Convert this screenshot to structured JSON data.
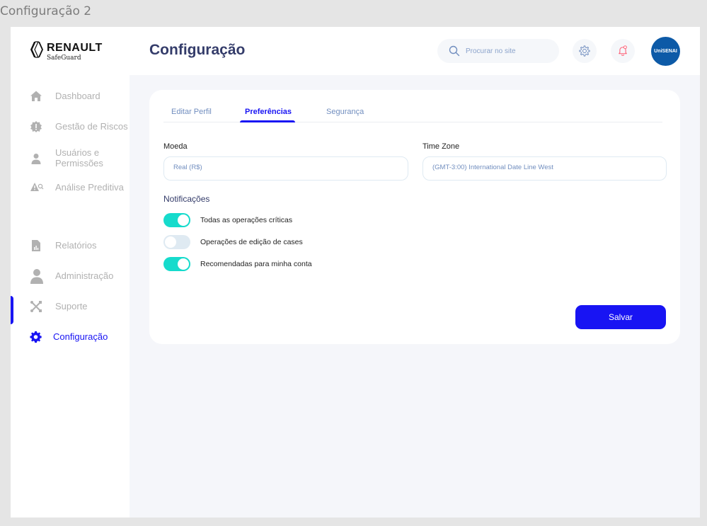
{
  "frame_label": "Configuração 2",
  "brand": {
    "name": "RENAULT",
    "sub": "SafeGuard"
  },
  "header": {
    "title": "Configuração",
    "search": {
      "placeholder": "Procurar no site",
      "icon": "search-icon"
    },
    "settings_icon": "gear-icon",
    "notification_icon": "bell-icon",
    "avatar_text": "UniSENAI"
  },
  "sidebar": {
    "items": [
      {
        "label": "Dashboard",
        "icon": "home-icon",
        "active": false
      },
      {
        "label": "Gestão de Riscos",
        "icon": "risk-icon",
        "active": false
      },
      {
        "label": "Usuários e Permissões",
        "icon": "user-icon",
        "active": false
      },
      {
        "label": "Análise Preditiva",
        "icon": "warning-search-icon",
        "active": false
      },
      {
        "label": "Relatórios",
        "icon": "report-icon",
        "active": false
      },
      {
        "label": "Administração",
        "icon": "admin-icon",
        "active": false
      },
      {
        "label": "Suporte",
        "icon": "tools-icon",
        "active": false
      },
      {
        "label": "Configuração",
        "icon": "gear-icon",
        "active": true
      }
    ]
  },
  "tabs": [
    {
      "label": "Editar Perfil",
      "active": false
    },
    {
      "label": "Preferências",
      "active": true
    },
    {
      "label": "Segurança",
      "active": false
    }
  ],
  "form": {
    "currency": {
      "label": "Moeda",
      "value": "Real (R$)"
    },
    "timezone": {
      "label": "Time Zone",
      "value": "(GMT-3:00) International Date Line West"
    }
  },
  "notifications": {
    "title": "Notificações",
    "items": [
      {
        "label": "Todas as operações críticas",
        "enabled": true
      },
      {
        "label": "Operações de edição de cases",
        "enabled": false
      },
      {
        "label": "Recomendadas para minha conta",
        "enabled": true
      }
    ]
  },
  "save_label": "Salvar",
  "colors": {
    "accent": "#1814F3",
    "title": "#343C6A",
    "toggle_on": "#16DBCC",
    "toggle_off": "#DFEAF2",
    "muted": "#B1B1B1",
    "link": "#718EBF"
  }
}
